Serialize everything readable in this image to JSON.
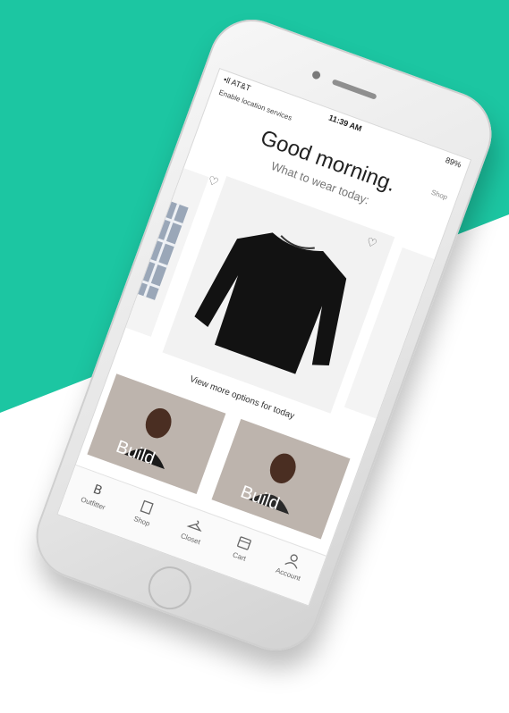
{
  "status": {
    "carrier": "•ll AT&T",
    "time": "11:39 AM",
    "battery": "89%"
  },
  "location_banner": "Enable location services",
  "greeting": "Good morning.",
  "subtitle": "What to wear today:",
  "help_label": "Shop",
  "more_options": "View more options for today",
  "tiles": [
    {
      "label": "Build"
    },
    {
      "label": "Build"
    }
  ],
  "tabs": [
    {
      "label": "Outfitter",
      "icon": "outfitter-icon"
    },
    {
      "label": "Shop",
      "icon": "shop-icon"
    },
    {
      "label": "Closet",
      "icon": "hanger-icon"
    },
    {
      "label": "Cart",
      "icon": "cart-icon"
    },
    {
      "label": "Account",
      "icon": "account-icon"
    }
  ],
  "colors": {
    "background_accent": "#1cc6a2",
    "sweater": "#121212"
  }
}
